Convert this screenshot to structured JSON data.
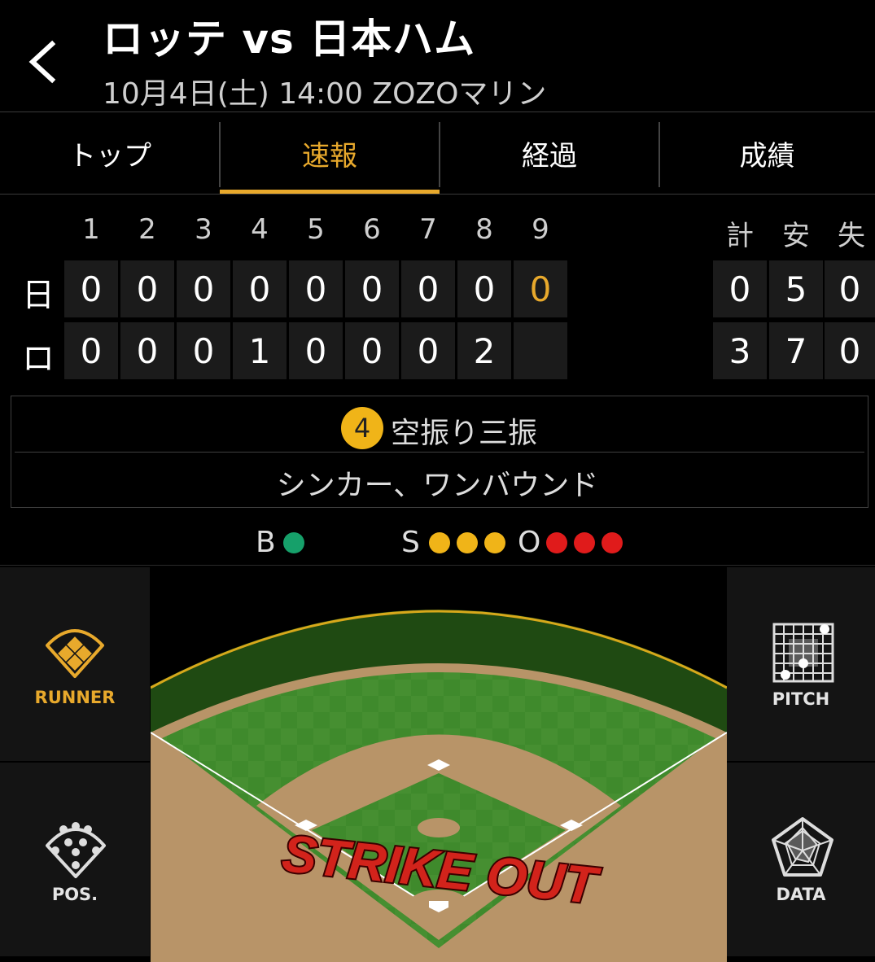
{
  "header": {
    "title": "ロッテ vs 日本ハム",
    "subtitle": "10月4日(土) 14:00 ZOZOマリン"
  },
  "tabs": [
    {
      "label": "トップ",
      "active": false
    },
    {
      "label": "速報",
      "active": true
    },
    {
      "label": "経過",
      "active": false
    },
    {
      "label": "成績",
      "active": false
    }
  ],
  "scoreboard": {
    "innings": [
      "1",
      "2",
      "3",
      "4",
      "5",
      "6",
      "7",
      "8",
      "9"
    ],
    "totals_headers": [
      "計",
      "安",
      "失"
    ],
    "rows": [
      {
        "team": "日",
        "scores": [
          "0",
          "0",
          "0",
          "0",
          "0",
          "0",
          "0",
          "0",
          "0"
        ],
        "totals": [
          "0",
          "5",
          "0"
        ]
      },
      {
        "team": "ロ",
        "scores": [
          "0",
          "0",
          "0",
          "1",
          "0",
          "0",
          "0",
          "2",
          ""
        ],
        "totals": [
          "3",
          "7",
          "0"
        ]
      }
    ]
  },
  "play": {
    "number": "4",
    "result": "空振り三振",
    "pitch": "シンカー、ワンバウンド"
  },
  "count": {
    "ball_label": "B",
    "balls": 1,
    "strike_label": "S",
    "strikes": 3,
    "out_label": "O",
    "outs": 3
  },
  "panels": {
    "runner": "RUNNER",
    "pitch": "PITCH",
    "pos": "POS.",
    "data": "DATA"
  },
  "field": {
    "banner": "STRIKE OUT"
  },
  "colors": {
    "accent": "#e8a92c",
    "ball": "#16a06a",
    "strike": "#f0b418",
    "out": "#e01b1b"
  }
}
